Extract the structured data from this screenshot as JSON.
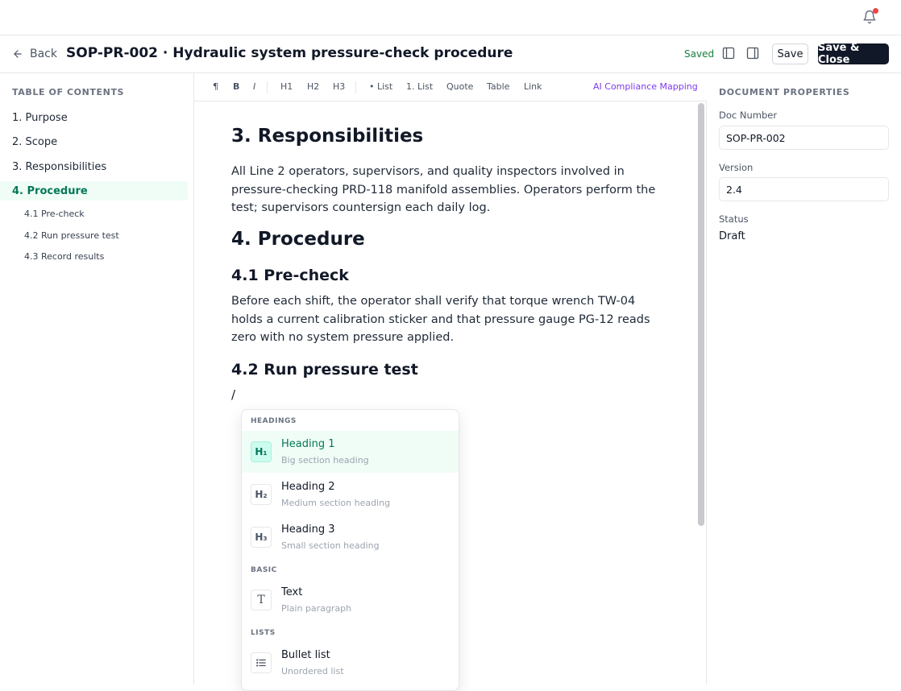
{
  "header": {
    "back_label": "Back",
    "title": "SOP-PR-002 · Hydraulic system pressure-check procedure",
    "status": "Saved",
    "save_label": "Save",
    "save_close_label": "Save & Close"
  },
  "toc": {
    "heading": "TABLE OF CONTENTS",
    "items": [
      "1. Purpose",
      "2. Scope",
      "3. Responsibilities",
      "4. Procedure"
    ],
    "subitems": [
      "4.1 Pre-check",
      "4.2 Run pressure test",
      "4.3 Record results"
    ]
  },
  "toolbar": {
    "paragraph": "¶",
    "bold": "B",
    "italic": "I",
    "h1": "H1",
    "h2": "H2",
    "h3": "H3",
    "bullet_list": "• List",
    "numbered_list": "1. List",
    "quote": "Quote",
    "table": "Table",
    "link": "Link",
    "ai": "AI Compliance Mapping"
  },
  "editor": {
    "h_responsibilities": "3. Responsibilities",
    "p_responsibilities": "All Line 2 operators, supervisors, and quality inspectors involved in pressure-checking PRD-118 manifold assemblies. Operators perform the test; supervisors countersign each daily log.",
    "h_procedure": "4. Procedure",
    "h_precheck": "4.1 Pre-check",
    "p_precheck": "Before each shift, the operator shall verify that torque wrench TW-04 holds a current calibration sticker and that pressure gauge PG-12 reads zero with no system pressure applied.",
    "h_run": "4.2 Run pressure test",
    "slash": "/"
  },
  "slash_menu": {
    "sections": {
      "headings": "HEADINGS",
      "basic": "BASIC",
      "lists": "LISTS"
    },
    "items": [
      {
        "icon": "H₁",
        "label": "Heading 1",
        "desc": "Big section heading"
      },
      {
        "icon": "H₂",
        "label": "Heading 2",
        "desc": "Medium section heading"
      },
      {
        "icon": "H₃",
        "label": "Heading 3",
        "desc": "Small section heading"
      },
      {
        "icon": "T",
        "label": "Text",
        "desc": "Plain paragraph"
      },
      {
        "icon": "list-icon",
        "label": "Bullet list",
        "desc": "Unordered list"
      }
    ]
  },
  "properties": {
    "heading": "DOCUMENT PROPERTIES",
    "doc_number_label": "Doc Number",
    "doc_number": "SOP-PR-002",
    "version_label": "Version",
    "version": "2.4",
    "status_label": "Status",
    "status": "Draft"
  },
  "colors": {
    "accent": "#047857",
    "accent_bg": "#f0fdf7",
    "ai_purple": "#7c3aed",
    "saved_green": "#15803d",
    "notification_dot": "#ef4444"
  }
}
